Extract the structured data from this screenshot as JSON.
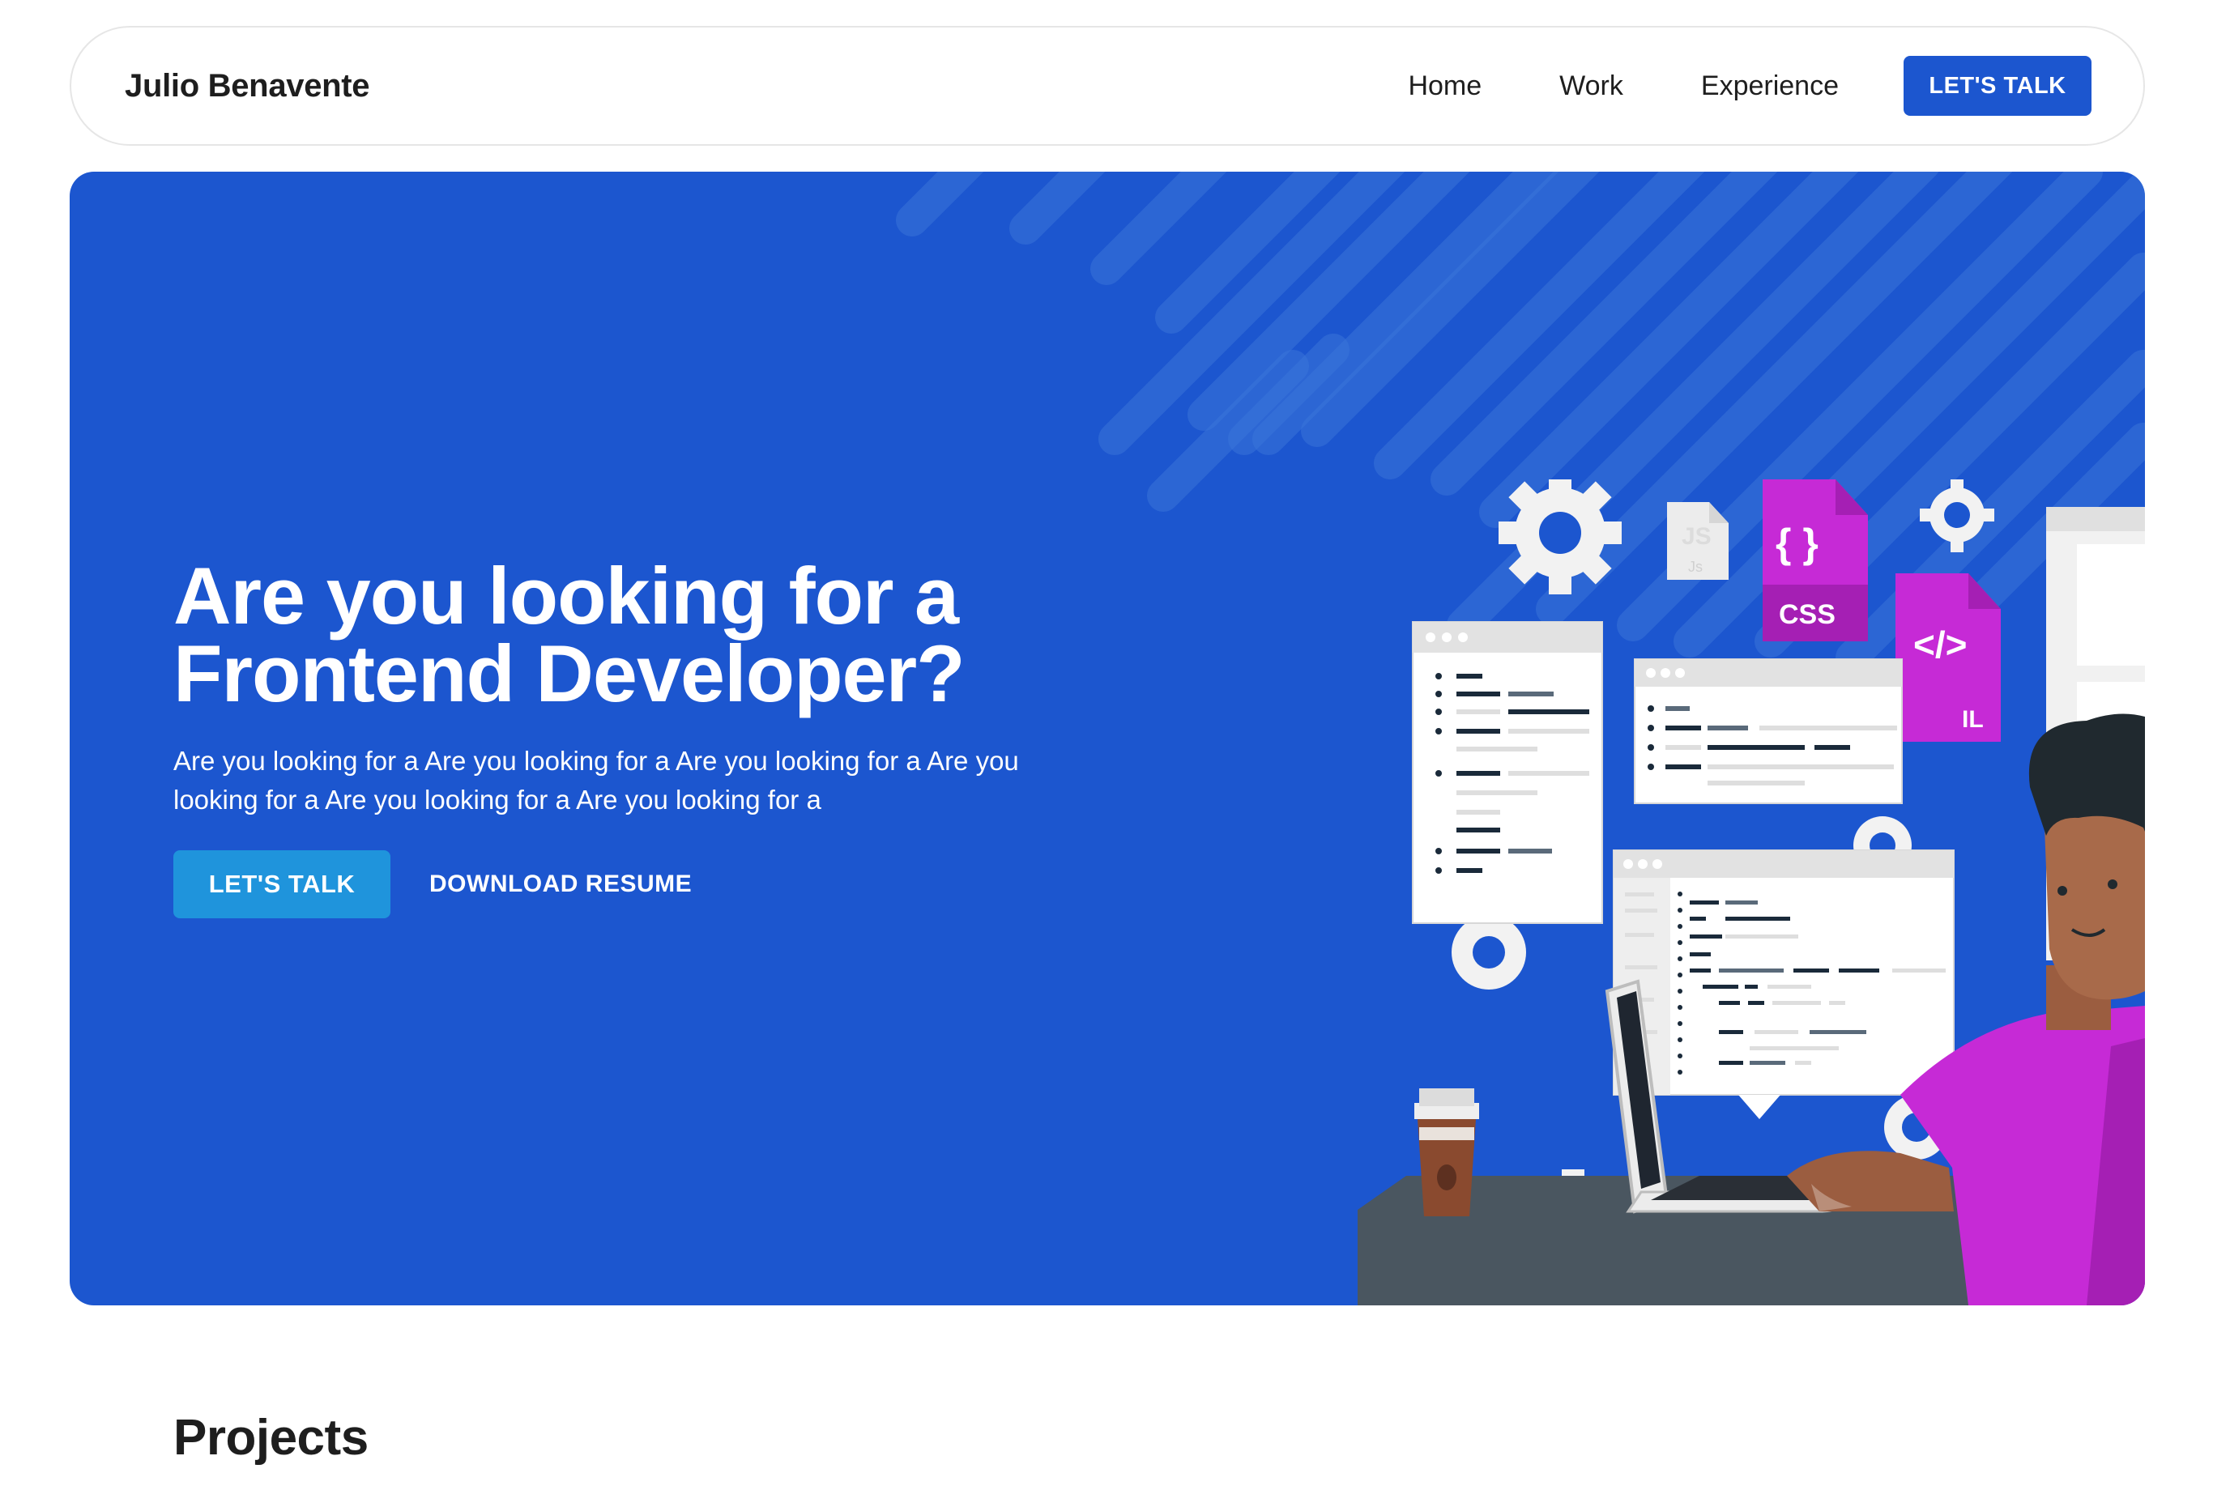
{
  "nav": {
    "brand": "Julio Benavente",
    "links": [
      {
        "label": "Home"
      },
      {
        "label": "Work"
      },
      {
        "label": "Experience"
      }
    ],
    "cta_label": "LET'S TALK"
  },
  "hero": {
    "title_line1": "Are you looking for a",
    "title_line2": "Frontend Developer?",
    "subtitle_line1": "Are you looking for a Are you looking for a Are you looking for a Are you",
    "subtitle_line2": "looking for a Are you looking for a Are you looking for a",
    "cta_label": "LET'S TALK",
    "download_label": "DOWNLOAD RESUME",
    "illustration": {
      "file_labels": {
        "js": "JS",
        "js_small": "Js",
        "css": "CSS",
        "css_glyph": "{ }",
        "html": "</>",
        "html_partial": "IL"
      }
    }
  },
  "projects": {
    "title": "Projects"
  },
  "colors": {
    "primary": "#1c56cf",
    "accent_button": "#1f94dc",
    "magenta": "#c62ad6",
    "skin": "#a86a4a"
  }
}
